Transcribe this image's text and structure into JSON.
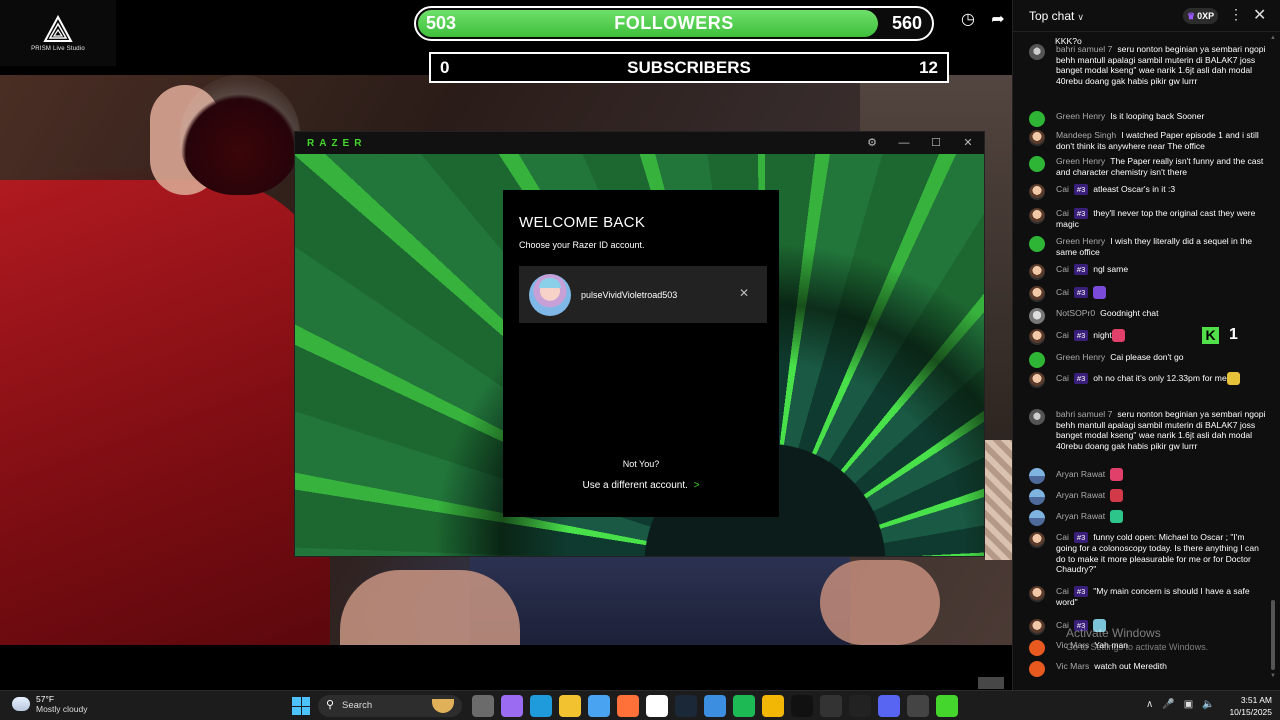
{
  "overlay": {
    "logo_text": "PRISM Live Studio",
    "followers": {
      "current": "503",
      "label": "FOLLOWERS",
      "goal": "560",
      "progress": 0.898
    },
    "subscribers": {
      "current": "0",
      "label": "SUBSCRIBERS",
      "goal": "12"
    },
    "top_icons": [
      "clock-icon",
      "share-icon"
    ]
  },
  "razer": {
    "brand": "RAZER",
    "window_controls": [
      "settings-icon",
      "minimize-icon",
      "maximize-icon",
      "close-icon"
    ],
    "title": "WELCOME BACK",
    "subtitle": "Choose your Razer ID account.",
    "account_name": "pulseVividVioletroad503",
    "not_you": "Not You?",
    "different_account": "Use a different account.",
    "different_account_chevron": ">",
    "brand_color": "#44d62c"
  },
  "chat": {
    "header_title": "Top chat",
    "oxp_label": "0XP",
    "top_fragment": "KKK?o",
    "messages": [
      {
        "author": "bahri samuel 7",
        "badge": "",
        "text": "seru nonton beginian ya sembari ngopi behh mantull apalagi sambil muterin di BALAK7 joss banget modal kseng\" wae narik 1.6jt asli dah modal 40rebu doang gak habis pikir gw lurrr",
        "avatar": "bahri"
      },
      {
        "author": "Green Henry",
        "badge": "",
        "text": "Is it looping back Sooner",
        "avatar": "green"
      },
      {
        "author": "Mandeep Singh",
        "badge": "",
        "text": "I watched Paper episode 1 and i still don't think its anywhere near The office",
        "avatar": "portrait"
      },
      {
        "author": "Green Henry",
        "badge": "",
        "text": "The Paper really isn't funny and the cast and character chemistry isn't there",
        "avatar": "green"
      },
      {
        "author": "Cai",
        "badge": "#3",
        "text": "atleast Oscar's in it :3",
        "avatar": "portrait"
      },
      {
        "author": "Cai",
        "badge": "#3",
        "text": "they'll never top the original cast they were magic",
        "avatar": "portrait"
      },
      {
        "author": "Green Henry",
        "badge": "",
        "text": "I wish they literally did a sequel in the same office",
        "avatar": "green"
      },
      {
        "author": "Cai",
        "badge": "#3",
        "text": "ngl same",
        "avatar": "portrait"
      },
      {
        "author": "Cai",
        "badge": "#3",
        "text": "",
        "avatar": "portrait",
        "emoji": "#7a4bd8"
      },
      {
        "author": "NotSOPr0",
        "badge": "",
        "text": "Goodnight chat",
        "avatar": "cat"
      },
      {
        "author": "Cai",
        "badge": "#3",
        "text": "night",
        "avatar": "portrait",
        "emoji": "#e0406a"
      },
      {
        "author": "Green Henry",
        "badge": "",
        "text": "Cai please don't go",
        "avatar": "green"
      },
      {
        "author": "Cai",
        "badge": "#3",
        "text": "oh no chat it's only 12.33pm for me",
        "avatar": "portrait",
        "emoji": "#e5c23a"
      },
      {
        "author": "bahri samuel 7",
        "badge": "",
        "text": "seru nonton beginian ya sembari ngopi behh mantull apalagi sambil muterin di BALAK7 joss banget modal kseng\" wae narik 1.6jt asli dah modal 40rebu doang gak habis pikir gw lurrr",
        "avatar": "bahri"
      },
      {
        "author": "Aryan Rawat",
        "badge": "",
        "text": "",
        "avatar": "landscape",
        "emoji": "#e0406a"
      },
      {
        "author": "Aryan Rawat",
        "badge": "",
        "text": "",
        "avatar": "landscape",
        "emoji": "#d23a4a"
      },
      {
        "author": "Aryan Rawat",
        "badge": "",
        "text": "",
        "avatar": "landscape",
        "emoji": "#2ec58a"
      },
      {
        "author": "Cai",
        "badge": "#3",
        "text": "funny cold open: Michael to Oscar ; \"I'm going for a colonoscopy today. Is there anything I can do to make it more pleasurable for me or for Doctor Chaudry?\"",
        "avatar": "portrait"
      },
      {
        "author": "Cai",
        "badge": "#3",
        "text": "\"My main concern is should I have a safe word\"",
        "avatar": "portrait"
      },
      {
        "author": "Cai",
        "badge": "#3",
        "text": "",
        "avatar": "portrait",
        "emoji": "#7cc4d8"
      },
      {
        "author": "Vic Mars",
        "badge": "",
        "text": "Yah man",
        "avatar": "orange"
      },
      {
        "author": "Vic Mars",
        "badge": "",
        "text": "watch out Meredith",
        "avatar": "orange"
      }
    ],
    "k_counter": {
      "icon": "kick-k-icon",
      "count": "1"
    }
  },
  "activation": {
    "line1": "Activate Windows",
    "line2": "Go to Settings to activate Windows."
  },
  "taskbar": {
    "temperature": "57°F",
    "weather": "Mostly cloudy",
    "search_label": "Search",
    "time": "3:51 AM",
    "date": "10/15/2025",
    "pinned_apps": [
      "task-view-icon",
      "copilot-icon",
      "edge-icon",
      "file-explorer-icon",
      "store-icon",
      "firefox-icon",
      "mail-icon",
      "steam-icon",
      "photos-icon",
      "spotify-icon",
      "chrome-icon",
      "terminal-icon",
      "epic-games-icon",
      "tiktok-icon",
      "discord-icon",
      "obs-icon",
      "razer-synapse-icon"
    ],
    "pinned_colors": [
      "#6b6b6b",
      "#9b6cf2",
      "#1f9adb",
      "#f2c230",
      "#4aa3f0",
      "#ff7139",
      "#ffffff",
      "#1b2838",
      "#3c8fe0",
      "#1db954",
      "#f2b705",
      "#111111",
      "#333333",
      "#222222",
      "#5865f2",
      "#444444",
      "#44d62c"
    ]
  }
}
